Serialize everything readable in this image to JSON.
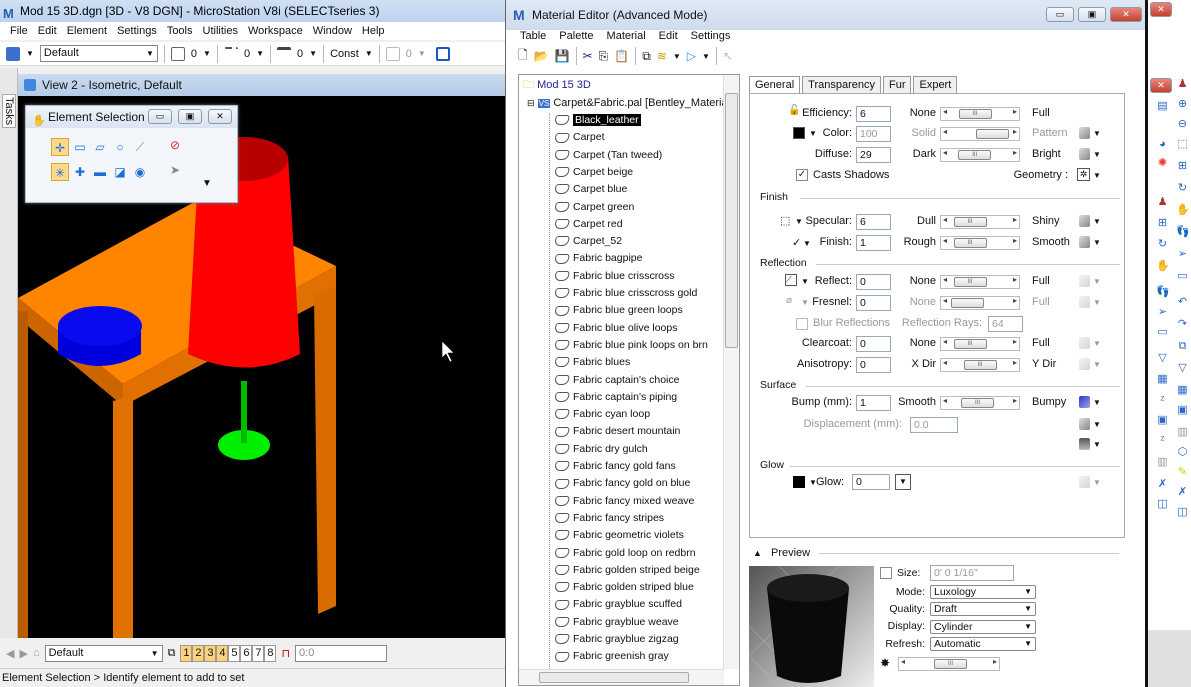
{
  "ms": {
    "title": "Mod 15 3D.dgn [3D - V8 DGN] - MicroStation V8i (SELECTseries 3)",
    "menu": [
      "File",
      "Edit",
      "Element",
      "Settings",
      "Tools",
      "Utilities",
      "Workspace",
      "Window",
      "Help"
    ],
    "toolbar": {
      "level": "Default",
      "color": "0",
      "style": "0",
      "weight": "0",
      "class": "Const",
      "transparency": "0"
    },
    "view_title": "View 2 - Isometric, Default",
    "tasks_label": "Tasks",
    "element_selection": {
      "title": "Element Selection",
      "row1_icons": [
        "individual-icon",
        "block-icon",
        "shape-icon",
        "circle-icon",
        "line-icon"
      ],
      "row2_icons": [
        "new-icon",
        "add-icon",
        "subtract-icon",
        "invert-icon",
        "select-all-icon"
      ]
    },
    "bottom": {
      "view_group": "Default",
      "views": [
        "1",
        "2",
        "3",
        "4",
        "5",
        "6",
        "7",
        "8"
      ],
      "active_views": [
        "1",
        "2",
        "3",
        "4"
      ],
      "coord": "0:0"
    },
    "status": "Element Selection > Identify element to add to set"
  },
  "scene_colors": {
    "table": "#ff8400",
    "lamp_shade": "#ff0000",
    "lamp_base": "#00ee00",
    "bowl": "#0000ee"
  },
  "me": {
    "title": "Material Editor (Advanced Mode)",
    "menu": [
      "Table",
      "Palette",
      "Material",
      "Edit",
      "Settings"
    ],
    "tree": {
      "root": "Mod 15 3D",
      "palette": "Carpet&Fabric.pal [Bentley_Materia...",
      "selected": "Black_leather",
      "items": [
        "Black_leather",
        "Carpet",
        "Carpet (Tan tweed)",
        "Carpet beige",
        "Carpet blue",
        "Carpet green",
        "Carpet red",
        "Carpet_52",
        "Fabric bagpipe",
        "Fabric blue crisscross",
        "Fabric blue crisscross gold",
        "Fabric blue green loops",
        "Fabric blue olive loops",
        "Fabric blue pink loops on brn",
        "Fabric blues",
        "Fabric captain's choice",
        "Fabric captain's piping",
        "Fabric cyan loop",
        "Fabric desert mountain",
        "Fabric dry gulch",
        "Fabric fancy gold fans",
        "Fabric fancy gold on blue",
        "Fabric fancy mixed weave",
        "Fabric fancy stripes",
        "Fabric geometric violets",
        "Fabric gold loop on redbrn",
        "Fabric golden striped beige",
        "Fabric golden striped blue",
        "Fabric grayblue scuffed",
        "Fabric grayblue weave",
        "Fabric grayblue zigzag",
        "Fabric greenish gray"
      ]
    },
    "tabs": [
      "General",
      "Transparency",
      "Fur",
      "Expert"
    ],
    "active_tab": "General",
    "general": {
      "efficiency": {
        "label": "Efficiency:",
        "value": "6",
        "min": "None",
        "max": "Full",
        "slider": 0.3
      },
      "color": {
        "label": "Color:",
        "value": "100",
        "min": "Solid",
        "max": "Pattern",
        "slider": 1.0,
        "swatch": "#000000"
      },
      "diffuse": {
        "label": "Diffuse:",
        "value": "29",
        "min": "Dark",
        "max": "Bright",
        "slider": 0.29
      },
      "casts_shadows": {
        "label": "Casts Shadows",
        "checked": true
      },
      "geometry_label": "Geometry :"
    },
    "finish": {
      "title": "Finish",
      "specular": {
        "label": "Specular:",
        "value": "6",
        "min": "Dull",
        "max": "Shiny",
        "slider": 0.1
      },
      "finish": {
        "label": "Finish:",
        "value": "1",
        "min": "Rough",
        "max": "Smooth",
        "slider": 0.1
      }
    },
    "reflection": {
      "title": "Reflection",
      "reflect": {
        "label": "Reflect:",
        "value": "0",
        "min": "None",
        "max": "Full",
        "slider": 0.1
      },
      "fresnel": {
        "label": "Fresnel:",
        "value": "0",
        "min": "None",
        "max": "Full",
        "slider": 0.0
      },
      "blur": {
        "label": "Blur Reflections",
        "checked": false
      },
      "rays": {
        "label": "Reflection Rays:",
        "value": "64"
      },
      "clearcoat": {
        "label": "Clearcoat:",
        "value": "0",
        "min": "None",
        "max": "Full",
        "slider": 0.1
      },
      "anisotropy": {
        "label": "Anisotropy:",
        "value": "0",
        "min": "X Dir",
        "max": "Y Dir",
        "slider": 0.5
      }
    },
    "surface": {
      "title": "Surface",
      "bump": {
        "label": "Bump (mm):",
        "value": "1",
        "min": "Smooth",
        "max": "Bumpy",
        "slider": 0.4
      },
      "displacement": {
        "label": "Displacement (mm):",
        "value": "0.0"
      }
    },
    "glow": {
      "title": "Glow",
      "label": "Glow:",
      "value": "0"
    },
    "preview": {
      "title": "Preview",
      "size": {
        "label": "Size:",
        "value": "0' 0 1/16\"",
        "checked": false
      },
      "mode": {
        "label": "Mode:",
        "value": "Luxology"
      },
      "quality": {
        "label": "Quality:",
        "value": "Draft"
      },
      "display": {
        "label": "Display:",
        "value": "Cylinder"
      },
      "refresh": {
        "label": "Refresh:",
        "value": "Automatic"
      }
    }
  }
}
